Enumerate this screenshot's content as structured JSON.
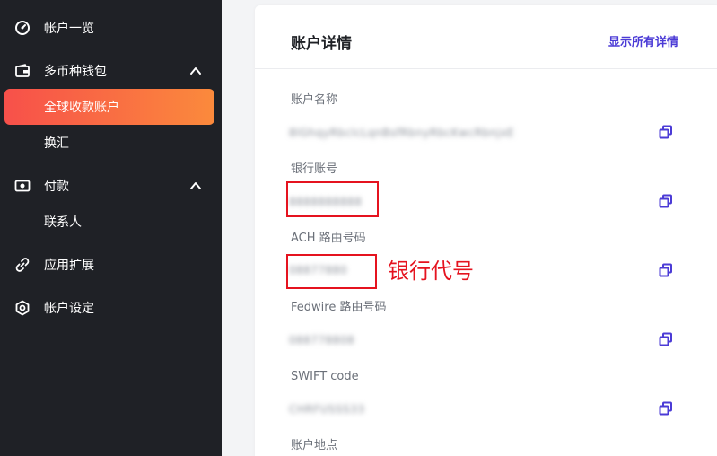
{
  "sidebar": {
    "items": [
      {
        "label": "帐户一览",
        "icon": "dashboard-icon"
      },
      {
        "label": "多币种钱包",
        "icon": "wallet-icon",
        "expanded": true
      },
      {
        "label": "全球收款账户",
        "active": true
      },
      {
        "label": "换汇"
      },
      {
        "label": "付款",
        "icon": "payment-icon",
        "expanded": true
      },
      {
        "label": "联系人"
      },
      {
        "label": "应用扩展",
        "icon": "link-icon"
      },
      {
        "label": "帐户设定",
        "icon": "settings-icon"
      }
    ]
  },
  "card": {
    "title": "账户详情",
    "show_all_link": "显示所有详情",
    "fields": [
      {
        "label": "账户名称",
        "value": "8lGhqyRbclcLqnBsfRbnyRbcKwcRbnjxE"
      },
      {
        "label": "银行账号",
        "value": "8888888888"
      },
      {
        "label": "ACH 路由号码",
        "value": "08877880"
      },
      {
        "label": "Fedwire 路由号码",
        "value": "088778808"
      },
      {
        "label": "SWIFT code",
        "value": "CHRFUSSS33"
      },
      {
        "label": "账户地点",
        "value": ""
      }
    ]
  },
  "annotation": {
    "text": "银行代号",
    "color": "#e5131f"
  },
  "colors": {
    "sidebar_bg": "#1f2126",
    "accent_gradient_start": "#f7504a",
    "accent_gradient_end": "#fb8a3c",
    "link": "#4b3bd6",
    "copy_icon": "#4b3bd6"
  }
}
